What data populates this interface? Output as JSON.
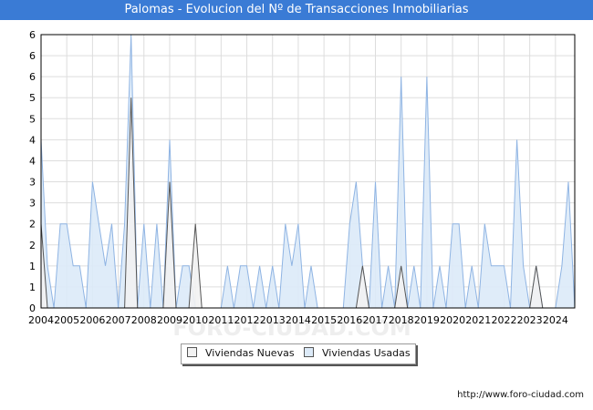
{
  "title": "Palomas - Evolucion del Nº de Transacciones Inmobiliarias",
  "source": "http://www.foro-ciudad.com",
  "watermark": "FORO-CIUDAD.COM",
  "chart_data": {
    "type": "area",
    "x_range": [
      2004,
      2024.75
    ],
    "ylim": [
      0,
      6.5
    ],
    "y_tick_values": [
      0,
      0.5,
      1,
      1.5,
      2,
      2.5,
      3,
      3.5,
      4,
      4.5,
      5,
      5.5,
      6,
      6.5
    ],
    "y_tick_labels": [
      "0",
      "1",
      "1",
      "2",
      "2",
      "3",
      "3",
      "4",
      "4",
      "5",
      "5",
      "6",
      "6",
      "6"
    ],
    "x_tick_labels": [
      "2004",
      "2005",
      "2006",
      "2007",
      "2008",
      "2009",
      "2010",
      "2011",
      "2012",
      "2013",
      "2014",
      "2015",
      "2016",
      "2017",
      "2018",
      "2019",
      "2020",
      "2021",
      "2022",
      "2023",
      "2024"
    ],
    "grid": true,
    "legend_position": "bottom-center",
    "colors": {
      "nuevas_fill": "#f2f2f2",
      "nuevas_line": "#555555",
      "usadas_fill": "#dceaf8",
      "usadas_line": "#8fb4e3"
    },
    "series": [
      {
        "name": "Viviendas Usadas",
        "x": [
          2004,
          2004.25,
          2004.5,
          2004.75,
          2005,
          2005.25,
          2005.5,
          2005.75,
          2006,
          2006.25,
          2006.5,
          2006.75,
          2007,
          2007.25,
          2007.5,
          2007.75,
          2008,
          2008.25,
          2008.5,
          2008.75,
          2009,
          2009.25,
          2009.5,
          2009.75,
          2010,
          2010.25,
          2010.5,
          2010.75,
          2011,
          2011.25,
          2011.5,
          2011.75,
          2012,
          2012.25,
          2012.5,
          2012.75,
          2013,
          2013.25,
          2013.5,
          2013.75,
          2014,
          2014.25,
          2014.5,
          2014.75,
          2015,
          2015.25,
          2015.5,
          2015.75,
          2016,
          2016.25,
          2016.5,
          2016.75,
          2017,
          2017.25,
          2017.5,
          2017.75,
          2018,
          2018.25,
          2018.5,
          2018.75,
          2019,
          2019.25,
          2019.5,
          2019.75,
          2020,
          2020.25,
          2020.5,
          2020.75,
          2021,
          2021.25,
          2021.5,
          2021.75,
          2022,
          2022.25,
          2022.5,
          2022.75,
          2023,
          2023.25,
          2023.5,
          2023.75,
          2024,
          2024.25,
          2024.5,
          2024.75
        ],
        "values": [
          4,
          1,
          0,
          2,
          2,
          1,
          1,
          0,
          3,
          2,
          1,
          2,
          0,
          2,
          6.5,
          0,
          2,
          0,
          2,
          0,
          4,
          0,
          1,
          1,
          0,
          0,
          0,
          0,
          0,
          1,
          0,
          1,
          1,
          0,
          1,
          0,
          1,
          0,
          2,
          1,
          2,
          0,
          1,
          0,
          0,
          0,
          0,
          0,
          2,
          3,
          1,
          0,
          3,
          0,
          1,
          0,
          5.5,
          0,
          1,
          0,
          5.5,
          0,
          1,
          0,
          2,
          2,
          0,
          1,
          0,
          2,
          1,
          1,
          1,
          0,
          4,
          1,
          0,
          1,
          0,
          0,
          0,
          1,
          3,
          0
        ]
      },
      {
        "name": "Viviendas Nuevas",
        "x": [
          2004,
          2004.25,
          2004.5,
          2004.75,
          2005,
          2005.25,
          2005.5,
          2005.75,
          2006,
          2006.25,
          2006.5,
          2006.75,
          2007,
          2007.25,
          2007.5,
          2007.75,
          2008,
          2008.25,
          2008.5,
          2008.75,
          2009,
          2009.25,
          2009.5,
          2009.75,
          2010,
          2010.25,
          2010.5,
          2010.75,
          2011,
          2011.25,
          2011.5,
          2011.75,
          2012,
          2012.25,
          2012.5,
          2012.75,
          2013,
          2013.25,
          2013.5,
          2013.75,
          2014,
          2014.25,
          2014.5,
          2014.75,
          2015,
          2015.25,
          2015.5,
          2015.75,
          2016,
          2016.25,
          2016.5,
          2016.75,
          2017,
          2017.25,
          2017.5,
          2017.75,
          2018,
          2018.25,
          2018.5,
          2018.75,
          2019,
          2019.25,
          2019.5,
          2019.75,
          2020,
          2020.25,
          2020.5,
          2020.75,
          2021,
          2021.25,
          2021.5,
          2021.75,
          2022,
          2022.25,
          2022.5,
          2022.75,
          2023,
          2023.25,
          2023.5,
          2023.75,
          2024,
          2024.25,
          2024.5,
          2024.75
        ],
        "values": [
          2,
          0,
          0,
          0,
          0,
          0,
          0,
          0,
          0,
          0,
          0,
          0,
          0,
          0,
          5,
          0,
          0,
          0,
          0,
          0,
          3,
          0,
          0,
          0,
          2,
          0,
          0,
          0,
          0,
          0,
          0,
          0,
          0,
          0,
          0,
          0,
          0,
          0,
          0,
          0,
          0,
          0,
          0,
          0,
          0,
          0,
          0,
          0,
          0,
          0,
          1,
          0,
          0,
          0,
          0,
          0,
          1,
          0,
          0,
          0,
          0,
          0,
          0,
          0,
          0,
          0,
          0,
          0,
          0,
          0,
          0,
          0,
          0,
          0,
          0,
          0,
          0,
          1,
          0,
          0,
          0,
          0,
          0,
          0
        ]
      }
    ]
  }
}
